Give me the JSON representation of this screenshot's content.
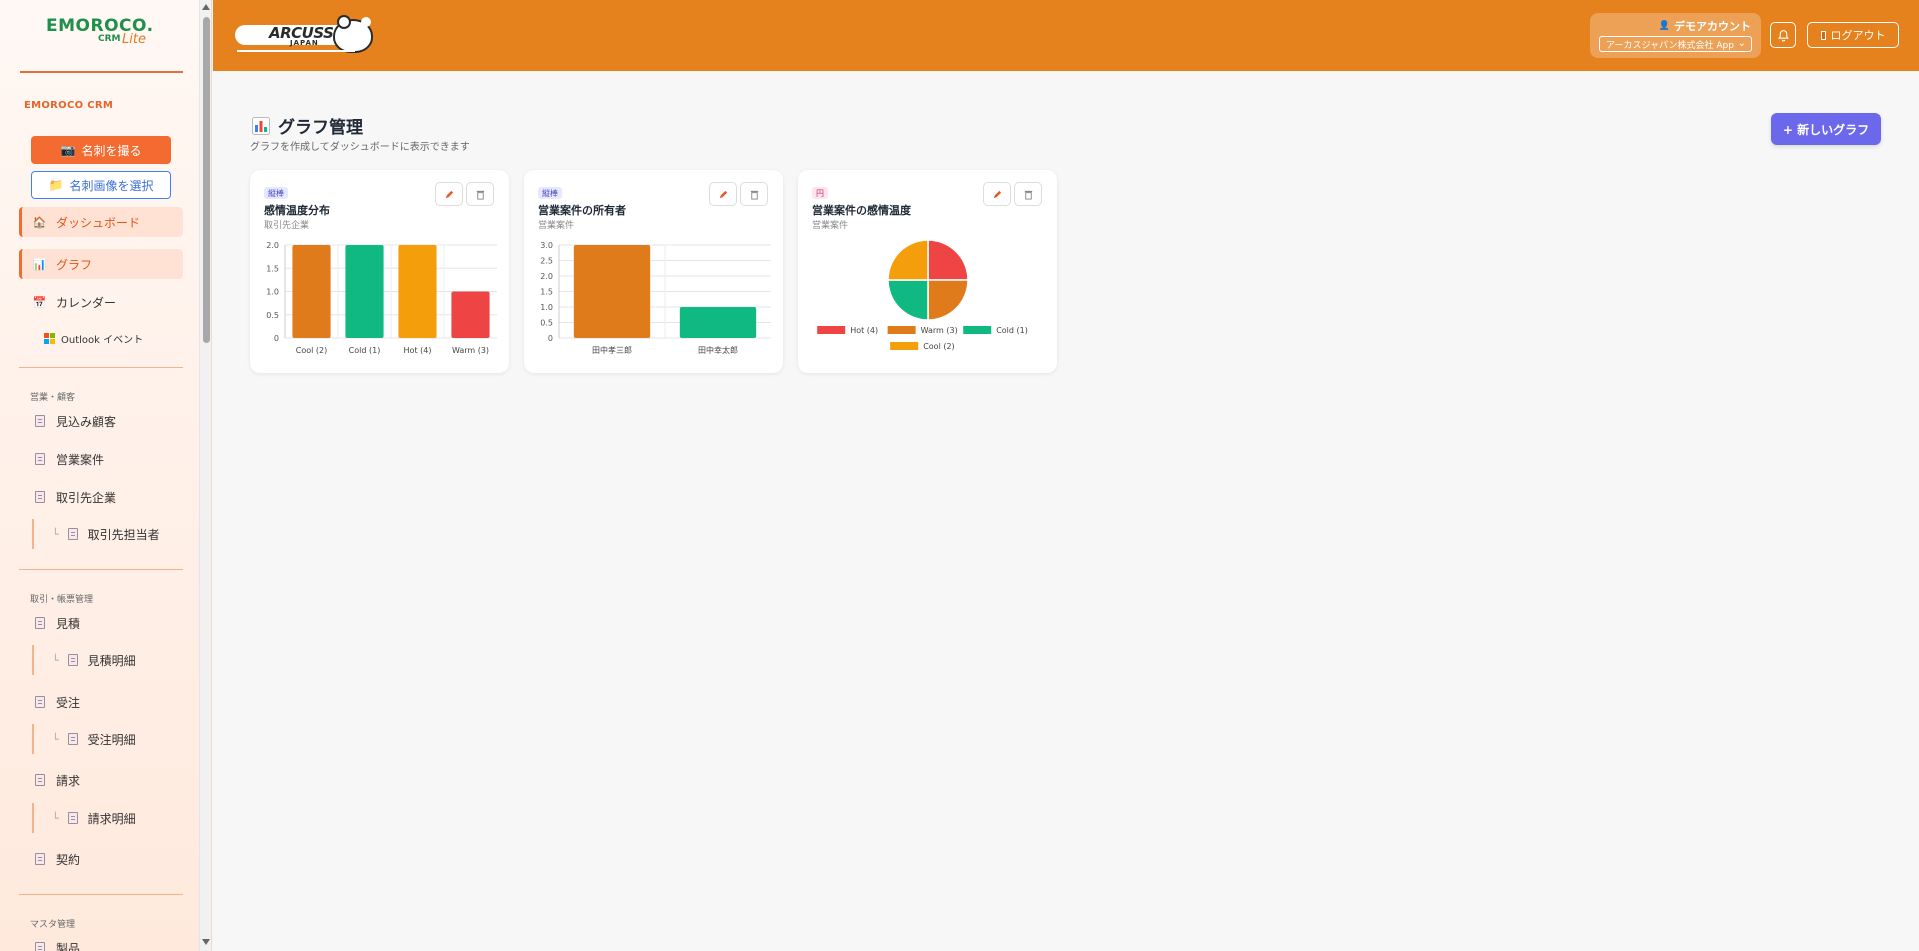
{
  "sidebar": {
    "logo": {
      "main": "EMOROCO.",
      "crm": "CRM",
      "lite": "Lite"
    },
    "brand_caption": "EMOROCO CRM",
    "scan_button": "名刺を撮る",
    "select_button": "名刺画像を選択",
    "nav": {
      "dashboard": "ダッシュボード",
      "graph": "グラフ",
      "calendar": "カレンダー",
      "outlook": "Outlook イベント"
    },
    "section_sales": "営業・顧客",
    "sales_items": [
      "見込み顧客",
      "営業案件",
      "取引先企業"
    ],
    "client_contact": "取引先担当者",
    "section_trade": "取引・帳票管理",
    "quote": "見積",
    "quote_detail": "見積明細",
    "order": "受注",
    "order_detail": "受注明細",
    "invoice": "請求",
    "invoice_detail": "請求明細",
    "contract": "契約",
    "section_master": "マスタ管理",
    "product": "製品"
  },
  "header": {
    "brand": "ARCUSS",
    "brand_sub": "JAPAN",
    "account_name": "デモアカウント",
    "org_select": "アーカスジャパン株式会社 App",
    "logout": "ログアウト"
  },
  "main": {
    "title": "グラフ管理",
    "subtitle": "グラフを作成してダッシュボードに表示できます",
    "new_button": "+ 新しいグラフ"
  },
  "cards": [
    {
      "badge": "縦棒",
      "title": "感情温度分布",
      "source": "取引先企業"
    },
    {
      "badge": "縦棒",
      "title": "営業案件の所有者",
      "source": "営業案件"
    },
    {
      "badge": "円",
      "title": "営業案件の感情温度",
      "source": "営業案件"
    }
  ],
  "colors": {
    "header": "#e6821e",
    "accent": "#f36b30",
    "primary": "#6b68ec",
    "orange": "#e07b1c",
    "green": "#10b981",
    "amber": "#f59e0b",
    "red": "#ef4444"
  },
  "chart_data": [
    {
      "type": "bar",
      "categories": [
        "Cool (2)",
        "Cold (1)",
        "Hot (4)",
        "Warm (3)"
      ],
      "values": [
        2,
        2,
        2,
        1
      ],
      "colors": [
        "#e07b1c",
        "#10b981",
        "#f59e0b",
        "#ef4444"
      ],
      "ylim": [
        0,
        2
      ],
      "yticks": [
        "0",
        "0.5",
        "1.0",
        "1.5",
        "2.0"
      ],
      "grid": true
    },
    {
      "type": "bar",
      "categories": [
        "田中孝三郎",
        "田中幸太郎"
      ],
      "values": [
        3,
        1
      ],
      "colors": [
        "#e07b1c",
        "#10b981"
      ],
      "ylim": [
        0,
        3
      ],
      "yticks": [
        "0",
        "0.5",
        "1.0",
        "1.5",
        "2.0",
        "2.5",
        "3.0"
      ],
      "grid": true
    },
    {
      "type": "pie",
      "labels": [
        "Hot (4)",
        "Warm (3)",
        "Cold (1)",
        "Cool (2)"
      ],
      "values": [
        1,
        1,
        1,
        1
      ],
      "colors": [
        "#ef4444",
        "#e07b1c",
        "#10b981",
        "#f59e0b"
      ],
      "legend": "bottom"
    }
  ]
}
